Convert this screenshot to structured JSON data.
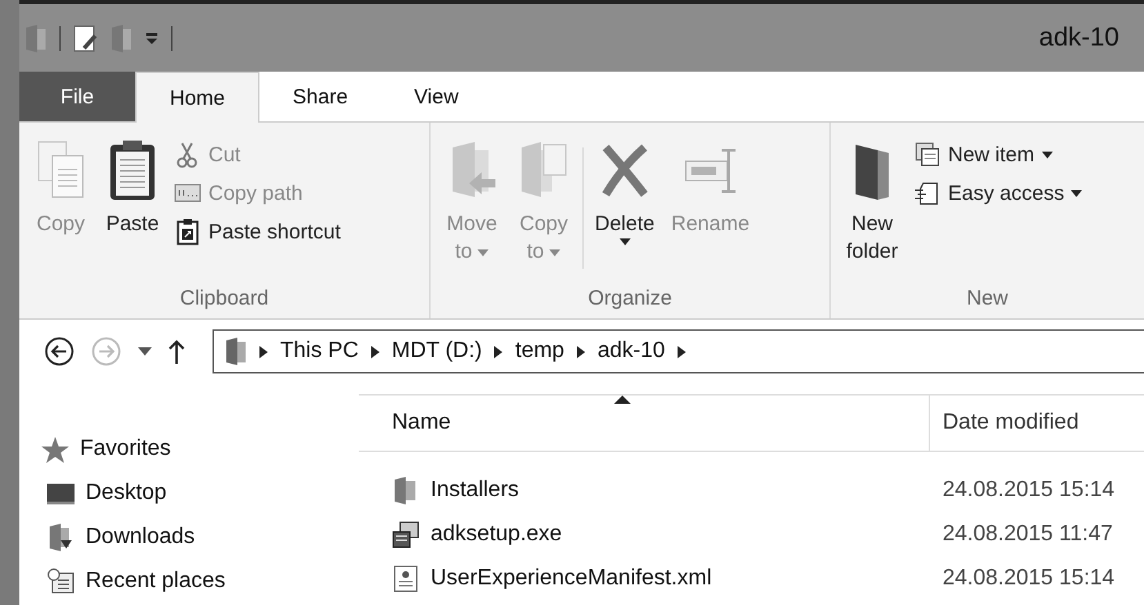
{
  "window": {
    "title": "adk-10"
  },
  "tabs": [
    {
      "label": "File",
      "kind": "file",
      "selected": false
    },
    {
      "label": "Home",
      "kind": "tab",
      "selected": true
    },
    {
      "label": "Share",
      "kind": "tab",
      "selected": false
    },
    {
      "label": "View",
      "kind": "tab",
      "selected": false
    }
  ],
  "ribbon": {
    "groups": [
      {
        "label": "Clipboard",
        "large": [
          {
            "lines": [
              "Copy"
            ],
            "kind": "copy",
            "disabled": true,
            "dropdown": false
          },
          {
            "lines": [
              "Paste"
            ],
            "kind": "paste",
            "disabled": false,
            "dropdown": false
          }
        ],
        "small": [
          {
            "label": "Cut",
            "kind": "cut",
            "disabled": true,
            "dropdown": false
          },
          {
            "label": "Copy path",
            "kind": "path",
            "disabled": true,
            "dropdown": false
          },
          {
            "label": "Paste shortcut",
            "kind": "shortcut",
            "disabled": false,
            "dropdown": false
          }
        ]
      },
      {
        "label": "Organize",
        "large": [
          {
            "lines": [
              "Move",
              "to"
            ],
            "kind": "move",
            "disabled": true,
            "dropdown": true
          },
          {
            "lines": [
              "Copy",
              "to"
            ],
            "kind": "copyto",
            "disabled": true,
            "dropdown": true
          },
          {
            "lines": [
              "Delete"
            ],
            "kind": "delete",
            "disabled": false,
            "dropdown": true
          },
          {
            "lines": [
              "Rename"
            ],
            "kind": "rename",
            "disabled": true,
            "dropdown": false
          }
        ]
      },
      {
        "label": "New",
        "large": [
          {
            "lines": [
              "New",
              "folder"
            ],
            "kind": "folder",
            "disabled": false,
            "dropdown": false
          }
        ],
        "small": [
          {
            "label": "New item",
            "kind": "newitem",
            "disabled": false,
            "dropdown": true
          },
          {
            "label": "Easy access",
            "kind": "easy",
            "disabled": false,
            "dropdown": true
          }
        ]
      }
    ]
  },
  "navigation": {
    "back_disabled": false,
    "forward_disabled": true
  },
  "address": {
    "crumbs": [
      "This PC",
      "MDT (D:)",
      "temp",
      "adk-10"
    ]
  },
  "sidebar": {
    "header": "Favorites",
    "items": [
      {
        "label": "Desktop",
        "kind": "desktop"
      },
      {
        "label": "Downloads",
        "kind": "downloads"
      },
      {
        "label": "Recent places",
        "kind": "recent"
      }
    ]
  },
  "table": {
    "columns": [
      {
        "label": "Name",
        "sorted": true
      },
      {
        "label": "Date modified",
        "sorted": false
      }
    ],
    "rows": [
      {
        "name": "Installers",
        "date": "24.08.2015 15:14",
        "kind": "folder"
      },
      {
        "name": "adksetup.exe",
        "date": "24.08.2015 11:47",
        "kind": "exe"
      },
      {
        "name": "UserExperienceManifest.xml",
        "date": "24.08.2015 15:14",
        "kind": "xml"
      }
    ]
  }
}
